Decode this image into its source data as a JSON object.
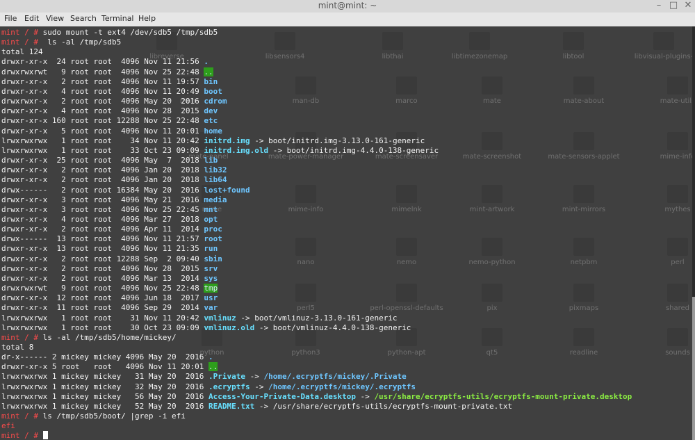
{
  "window": {
    "title": "mint@mint: ~",
    "controls": {
      "minimize": "–",
      "maximize": "□",
      "close": "✕"
    }
  },
  "menu": [
    "File",
    "Edit",
    "View",
    "Search",
    "Terminal",
    "Help"
  ],
  "prompt": "mint / #",
  "terminal": {
    "lines": [
      {
        "cmd": "sudo mount -t ext4 /dev/sdb5 /tmp/sdb5"
      },
      {
        "cmd": " ls -al /tmp/sdb5"
      },
      {
        "text": "total 124"
      },
      {
        "prefix": "drwxr-xr-x  24 root root  4096 Nov 11 21:56 ",
        "name": "."
      },
      {
        "prefix": "drwxrwxrwt   9 root root  4096 Nov 25 22:48 ",
        "name": ".."
      },
      {
        "prefix": "drwxr-xr-x   2 root root  4096 Nov 11 19:57 ",
        "name": "bin"
      },
      {
        "prefix": "drwxr-xr-x   4 root root  4096 Nov 11 20:49 ",
        "name": "boot"
      },
      {
        "prefix": "drwxrwxr-x   2 root root  4096 May 20  2016 ",
        "name": "cdrom"
      },
      {
        "prefix": "drwxr-xr-x   4 root root  4096 Nov 28  2015 ",
        "name": "dev"
      },
      {
        "prefix": "drwxr-xr-x 160 root root 12288 Nov 25 22:48 ",
        "name": "etc"
      },
      {
        "prefix": "drwxr-xr-x   5 root root  4096 Nov 11 20:01 ",
        "name": "home"
      },
      {
        "prefix": "lrwxrwxrwx   1 root root    34 Nov 11 20:42 ",
        "name": "initrd.img",
        "target": " -> boot/initrd.img-3.13.0-161-generic"
      },
      {
        "prefix": "lrwxrwxrwx   1 root root    33 Oct 23 09:09 ",
        "name": "initrd.img.old",
        "target": " -> boot/initrd.img-4.4.0-138-generic"
      },
      {
        "prefix": "drwxr-xr-x  25 root root  4096 May  7  2018 ",
        "name": "lib"
      },
      {
        "prefix": "drwxr-xr-x   2 root root  4096 Jan 20  2018 ",
        "name": "lib32"
      },
      {
        "prefix": "drwxr-xr-x   2 root root  4096 Jan 20  2018 ",
        "name": "lib64"
      },
      {
        "prefix": "drwx------   2 root root 16384 May 20  2016 ",
        "name": "lost+found"
      },
      {
        "prefix": "drwxr-xr-x   3 root root  4096 May 21  2016 ",
        "name": "media"
      },
      {
        "prefix": "drwxr-xr-x   3 root root  4096 Nov 25 22:45 ",
        "name": "mnt"
      },
      {
        "prefix": "drwxr-xr-x   4 root root  4096 Mar 27  2018 ",
        "name": "opt"
      },
      {
        "prefix": "drwxr-xr-x   2 root root  4096 Apr 11  2014 ",
        "name": "proc"
      },
      {
        "prefix": "drwx------  13 root root  4096 Nov 11 21:57 ",
        "name": "root"
      },
      {
        "prefix": "drwxr-xr-x  13 root root  4096 Nov 11 21:35 ",
        "name": "run"
      },
      {
        "prefix": "drwxr-xr-x   2 root root 12288 Sep  2 09:40 ",
        "name": "sbin"
      },
      {
        "prefix": "drwxr-xr-x   2 root root  4096 Nov 28  2015 ",
        "name": "srv"
      },
      {
        "prefix": "drwxr-xr-x   2 root root  4096 Mar 13  2014 ",
        "name": "sys"
      },
      {
        "prefix": "drwxrwxrwt   9 root root  4096 Nov 25 22:48 ",
        "name": "tmp"
      },
      {
        "prefix": "drwxr-xr-x  12 root root  4096 Jun 18  2017 ",
        "name": "usr"
      },
      {
        "prefix": "drwxr-xr-x  11 root root  4096 Sep 29  2014 ",
        "name": "var"
      },
      {
        "prefix": "lrwxrwxrwx   1 root root    31 Nov 11 20:42 ",
        "name": "vmlinuz",
        "target": " -> boot/vmlinuz-3.13.0-161-generic"
      },
      {
        "prefix": "lrwxrwxrwx   1 root root    30 Oct 23 09:09 ",
        "name": "vmlinuz.old",
        "target": " -> boot/vmlinuz-4.4.0-138-generic"
      },
      {
        "cmd": "ls -al /tmp/sdb5/home/mickey/"
      },
      {
        "text": "total 8"
      },
      {
        "prefix": "dr-x------ 2 mickey mickey 4096 May 20  2016 ",
        "name": "."
      },
      {
        "prefix": "drwxr-xr-x 5 root   root   4096 Nov 11 20:01 ",
        "name": ".."
      },
      {
        "prefix": "lrwxrwxrwx 1 mickey mickey   31 May 20  2016 ",
        "name": ".Private",
        "target": " -> /home/.ecryptfs/mickey/.Private"
      },
      {
        "prefix": "lrwxrwxrwx 1 mickey mickey   32 May 20  2016 ",
        "name": ".ecryptfs",
        "target": " -> /home/.ecryptfs/mickey/.ecryptfs"
      },
      {
        "prefix": "lrwxrwxrwx 1 mickey mickey   56 May 20  2016 ",
        "name": "Access-Your-Private-Data.desktop",
        "target": " -> /usr/share/ecryptfs-utils/ecryptfs-mount-private.desktop"
      },
      {
        "prefix": "lrwxrwxrwx 1 mickey mickey   52 May 20  2016 ",
        "name": "README.txt",
        "target": " -> /usr/share/ecryptfs-utils/ecryptfs-mount-private.txt"
      },
      {
        "cmd": "ls /tmp/sdb5/boot/ |grep -i efi"
      },
      {
        "text": "efi",
        "red": true
      },
      {
        "cmd": ""
      }
    ]
  },
  "background_labels": [
    "libreverse",
    "libsensors4",
    "libthai",
    "libtimezonemap",
    "libtool",
    "libvisual-plugins-",
    "man",
    "man-db",
    "marco",
    "mate",
    "mate-about",
    "mate-utils",
    "mate-panel",
    "mate-power-manager",
    "mate-screensaver",
    "mate-screenshot",
    "mate-sensors-applet",
    "mime-info",
    "mime",
    "mime-info",
    "mimelnk",
    "mint-artwork",
    "mint-mirrors",
    "mythes",
    "nano",
    "nemo",
    "nemo-python",
    "netpbm",
    "perl",
    "perl5",
    "perl-openssl-defaults",
    "pix",
    "pixmaps",
    "shared",
    "python",
    "python3",
    "python-apt",
    "qt5",
    "readline",
    "sounds"
  ]
}
